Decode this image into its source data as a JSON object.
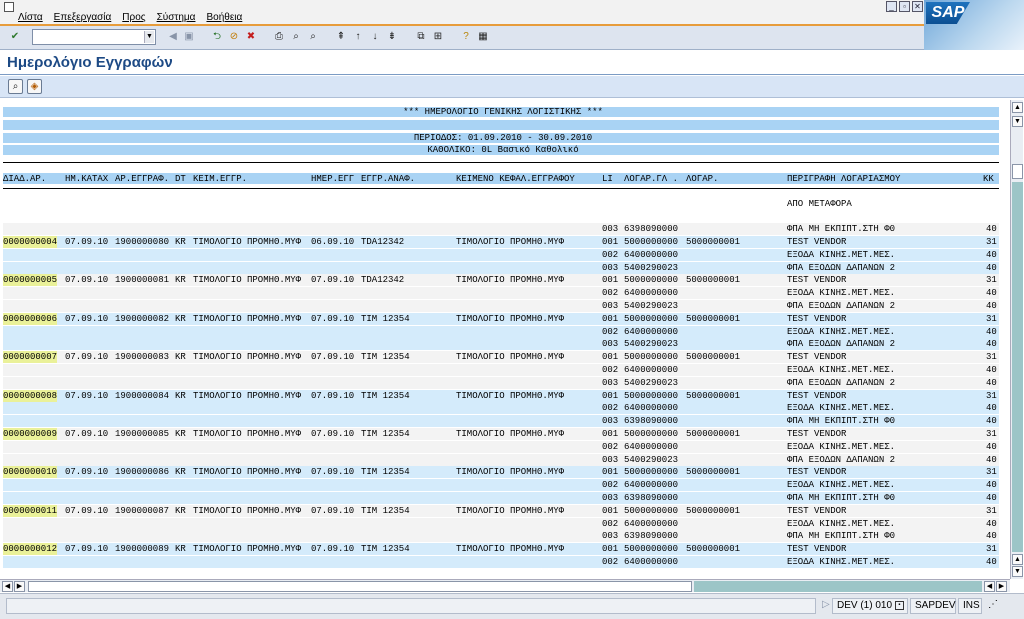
{
  "menu": [
    "Λίστα",
    "Επεξεργασία",
    "Προς",
    "Σύστημα",
    "Βοήθεια"
  ],
  "logo": "SAP",
  "title": "Ημερολόγιο Εγγραφών",
  "report": {
    "heading": "*** ΗΜΕΡΟΛΟΓΙΟ ΓΕΝΙΚΗΣ ΛΟΓΙΣΤΙΚΗΣ ***",
    "period": "ΠΕΡΙΟΔΟΣ: 01.09.2010 - 30.09.2010",
    "ledger": "ΚΑΘΟΛΙΚΟ: 0L Βασικό Καθολικό"
  },
  "columns": {
    "doc_no": "ΔΙΑΔ.ΑΡ.",
    "entry_date": "ΗΜ.ΚΑΤΑΧ",
    "doc_number": "ΑΡ.ΕΓΓΡΑΦ.",
    "doc_type": "DT",
    "doc_text": "ΚΕΙΜ.ΕΓΓΡ.",
    "doc_date": "ΗΜΕΡ.ΕΓΓ",
    "reference": "ΕΓΓΡ.ΑΝΑΦ.",
    "header_text": "ΚΕΙΜΕΝΟ ΚΕΦΑΛ.ΕΓΓΡΑΦΟΥ",
    "line_item": "LI",
    "gl_account": "ΛΟΓΑΡ.ΓΛ .",
    "account": "ΛΟΓΑΡ.",
    "account_desc": "ΠΕΡΙΓΡΑΦΗ ΛΟΓΑΡΙΑΣΜΟΥ",
    "posting_key": "ΚΚ"
  },
  "carry_forward": "ΑΠΟ ΜΕΤΑΦΟΡΑ",
  "carry_row": {
    "li": "003",
    "gl": "6398090000",
    "desc": "ΦΠΑ ΜΗ ΕΚΠΙΠΤ.ΣΤΗ Φ0",
    "kk": "40"
  },
  "documents": [
    {
      "doc": "0000000004",
      "entry": "07.09.10",
      "number": "1900000080",
      "dt": "KR",
      "text": "ΤΙΜΟΛΟΓΙΟ ΠΡΟΜΗΘ.ΜΥΦ",
      "date": "06.09.10",
      "ref": "TDA12342",
      "htext": "ΤΙΜΟΛΟΓΙΟ ΠΡΟΜΗΘ.ΜΥΦ",
      "lines": [
        [
          "001",
          "5000000000",
          "5000000001",
          "TEST VENDOR",
          "31"
        ],
        [
          "002",
          "6400000000",
          "",
          "ΕΞΟΔΑ ΚΙΝΗΣ.ΜΕΤ.ΜΕΣ.",
          "40"
        ],
        [
          "003",
          "5400290023",
          "",
          "ΦΠΑ ΕΞΟΔΩΝ ΔΑΠΑΝΩΝ 2",
          "40"
        ]
      ]
    },
    {
      "doc": "0000000005",
      "entry": "07.09.10",
      "number": "1900000081",
      "dt": "KR",
      "text": "ΤΙΜΟΛΟΓΙΟ ΠΡΟΜΗΘ.ΜΥΦ",
      "date": "07.09.10",
      "ref": "TDA12342",
      "htext": "ΤΙΜΟΛΟΓΙΟ ΠΡΟΜΗΘ.ΜΥΦ",
      "lines": [
        [
          "001",
          "5000000000",
          "5000000001",
          "TEST VENDOR",
          "31"
        ],
        [
          "002",
          "6400000000",
          "",
          "ΕΞΟΔΑ ΚΙΝΗΣ.ΜΕΤ.ΜΕΣ.",
          "40"
        ],
        [
          "003",
          "5400290023",
          "",
          "ΦΠΑ ΕΞΟΔΩΝ ΔΑΠΑΝΩΝ 2",
          "40"
        ]
      ]
    },
    {
      "doc": "0000000006",
      "entry": "07.09.10",
      "number": "1900000082",
      "dt": "KR",
      "text": "ΤΙΜΟΛΟΓΙΟ ΠΡΟΜΗΘ.ΜΥΦ",
      "date": "07.09.10",
      "ref": "TIM 12354",
      "htext": "ΤΙΜΟΛΟΓΙΟ ΠΡΟΜΗΘ.ΜΥΦ",
      "lines": [
        [
          "001",
          "5000000000",
          "5000000001",
          "TEST VENDOR",
          "31"
        ],
        [
          "002",
          "6400000000",
          "",
          "ΕΞΟΔΑ ΚΙΝΗΣ.ΜΕΤ.ΜΕΣ.",
          "40"
        ],
        [
          "003",
          "5400290023",
          "",
          "ΦΠΑ ΕΞΟΔΩΝ ΔΑΠΑΝΩΝ 2",
          "40"
        ]
      ]
    },
    {
      "doc": "0000000007",
      "entry": "07.09.10",
      "number": "1900000083",
      "dt": "KR",
      "text": "ΤΙΜΟΛΟΓΙΟ ΠΡΟΜΗΘ.ΜΥΦ",
      "date": "07.09.10",
      "ref": "TIM 12354",
      "htext": "ΤΙΜΟΛΟΓΙΟ ΠΡΟΜΗΘ.ΜΥΦ",
      "lines": [
        [
          "001",
          "5000000000",
          "5000000001",
          "TEST VENDOR",
          "31"
        ],
        [
          "002",
          "6400000000",
          "",
          "ΕΞΟΔΑ ΚΙΝΗΣ.ΜΕΤ.ΜΕΣ.",
          "40"
        ],
        [
          "003",
          "5400290023",
          "",
          "ΦΠΑ ΕΞΟΔΩΝ ΔΑΠΑΝΩΝ 2",
          "40"
        ]
      ]
    },
    {
      "doc": "0000000008",
      "entry": "07.09.10",
      "number": "1900000084",
      "dt": "KR",
      "text": "ΤΙΜΟΛΟΓΙΟ ΠΡΟΜΗΘ.ΜΥΦ",
      "date": "07.09.10",
      "ref": "TIM 12354",
      "htext": "ΤΙΜΟΛΟΓΙΟ ΠΡΟΜΗΘ.ΜΥΦ",
      "lines": [
        [
          "001",
          "5000000000",
          "5000000001",
          "TEST VENDOR",
          "31"
        ],
        [
          "002",
          "6400000000",
          "",
          "ΕΞΟΔΑ ΚΙΝΗΣ.ΜΕΤ.ΜΕΣ.",
          "40"
        ],
        [
          "003",
          "6398090000",
          "",
          "ΦΠΑ ΜΗ ΕΚΠΙΠΤ.ΣΤΗ Φ0",
          "40"
        ]
      ]
    },
    {
      "doc": "0000000009",
      "entry": "07.09.10",
      "number": "1900000085",
      "dt": "KR",
      "text": "ΤΙΜΟΛΟΓΙΟ ΠΡΟΜΗΘ.ΜΥΦ",
      "date": "07.09.10",
      "ref": "TIM 12354",
      "htext": "ΤΙΜΟΛΟΓΙΟ ΠΡΟΜΗΘ.ΜΥΦ",
      "lines": [
        [
          "001",
          "5000000000",
          "5000000001",
          "TEST VENDOR",
          "31"
        ],
        [
          "002",
          "6400000000",
          "",
          "ΕΞΟΔΑ ΚΙΝΗΣ.ΜΕΤ.ΜΕΣ.",
          "40"
        ],
        [
          "003",
          "5400290023",
          "",
          "ΦΠΑ ΕΞΟΔΩΝ ΔΑΠΑΝΩΝ 2",
          "40"
        ]
      ]
    },
    {
      "doc": "0000000010",
      "entry": "07.09.10",
      "number": "1900000086",
      "dt": "KR",
      "text": "ΤΙΜΟΛΟΓΙΟ ΠΡΟΜΗΘ.ΜΥΦ",
      "date": "07.09.10",
      "ref": "TIM 12354",
      "htext": "ΤΙΜΟΛΟΓΙΟ ΠΡΟΜΗΘ.ΜΥΦ",
      "lines": [
        [
          "001",
          "5000000000",
          "5000000001",
          "TEST VENDOR",
          "31"
        ],
        [
          "002",
          "6400000000",
          "",
          "ΕΞΟΔΑ ΚΙΝΗΣ.ΜΕΤ.ΜΕΣ.",
          "40"
        ],
        [
          "003",
          "6398090000",
          "",
          "ΦΠΑ ΜΗ ΕΚΠΙΠΤ.ΣΤΗ Φ0",
          "40"
        ]
      ]
    },
    {
      "doc": "0000000011",
      "entry": "07.09.10",
      "number": "1900000087",
      "dt": "KR",
      "text": "ΤΙΜΟΛΟΓΙΟ ΠΡΟΜΗΘ.ΜΥΦ",
      "date": "07.09.10",
      "ref": "TIM 12354",
      "htext": "ΤΙΜΟΛΟΓΙΟ ΠΡΟΜΗΘ.ΜΥΦ",
      "lines": [
        [
          "001",
          "5000000000",
          "5000000001",
          "TEST VENDOR",
          "31"
        ],
        [
          "002",
          "6400000000",
          "",
          "ΕΞΟΔΑ ΚΙΝΗΣ.ΜΕΤ.ΜΕΣ.",
          "40"
        ],
        [
          "003",
          "6398090000",
          "",
          "ΦΠΑ ΜΗ ΕΚΠΙΠΤ.ΣΤΗ Φ0",
          "40"
        ]
      ]
    },
    {
      "doc": "0000000012",
      "entry": "07.09.10",
      "number": "1900000089",
      "dt": "KR",
      "text": "ΤΙΜΟΛΟΓΙΟ ΠΡΟΜΗΘ.ΜΥΦ",
      "date": "07.09.10",
      "ref": "TIM 12354",
      "htext": "ΤΙΜΟΛΟΓΙΟ ΠΡΟΜΗΘ.ΜΥΦ",
      "lines": [
        [
          "001",
          "5000000000",
          "5000000001",
          "TEST VENDOR",
          "31"
        ],
        [
          "002",
          "6400000000",
          "",
          "ΕΞΟΔΑ ΚΙΝΗΣ.ΜΕΤ.ΜΕΣ.",
          "40"
        ]
      ]
    }
  ],
  "status": {
    "system": "DEV (1) 010",
    "server": "SAPDEV",
    "mode": "INS"
  },
  "colors": {
    "band": "#a9d3f4",
    "row_light": "#f3f3f3",
    "row_blue": "#d4ebfb",
    "doc_highlight": "#eaf199",
    "title": "#1d4a85"
  }
}
